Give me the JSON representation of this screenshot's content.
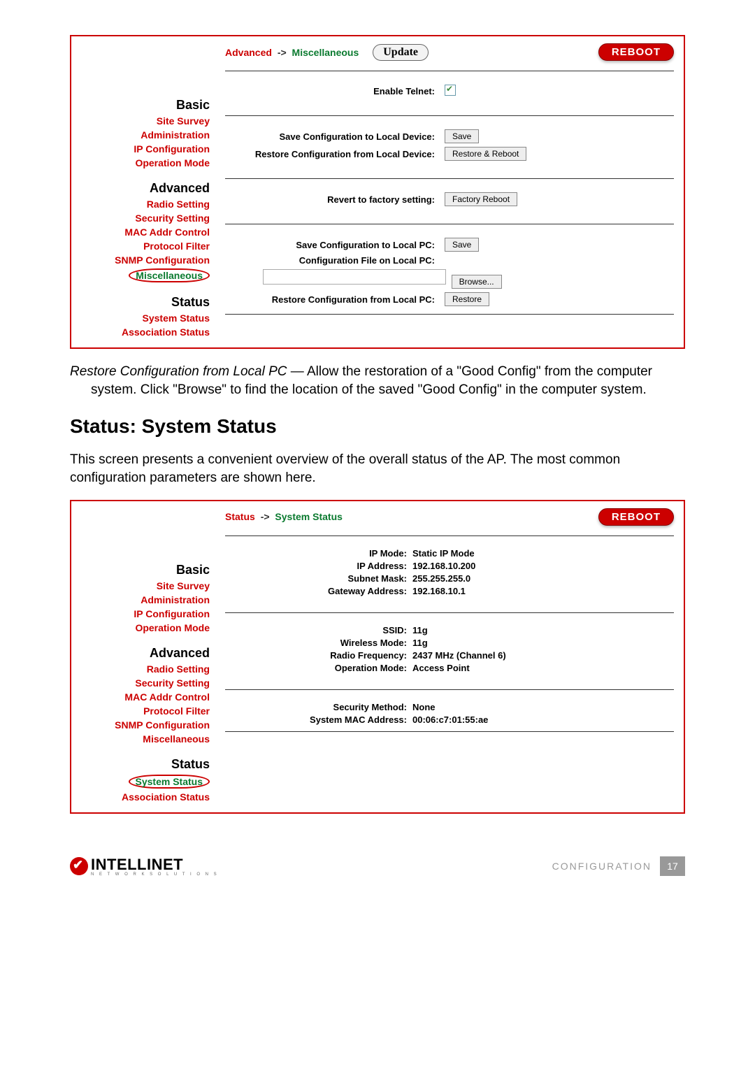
{
  "panel1": {
    "breadcrumb": {
      "root": "Advanced",
      "arrow": "->",
      "leaf": "Miscellaneous"
    },
    "update_btn": "Update",
    "reboot_btn": "REBOOT",
    "sidebar": {
      "basic": "Basic",
      "basic_items": [
        "Site Survey",
        "Administration",
        "IP Configuration",
        "Operation Mode"
      ],
      "advanced": "Advanced",
      "advanced_items": [
        "Radio Setting",
        "Security Setting",
        "MAC Addr Control",
        "Protocol Filter",
        "SNMP Configuration",
        "Miscellaneous"
      ],
      "status": "Status",
      "status_items": [
        "System Status",
        "Association Status"
      ]
    },
    "rows": {
      "enable_telnet": "Enable Telnet:",
      "save_local_device": "Save Configuration to Local Device:",
      "save_btn": "Save",
      "restore_local_device": "Restore Configuration from Local Device:",
      "restore_reboot_btn": "Restore & Reboot",
      "revert_factory": "Revert to factory setting:",
      "factory_reboot_btn": "Factory Reboot",
      "save_local_pc": "Save Configuration to Local PC:",
      "save_pc_btn": "Save",
      "config_file_pc": "Configuration File on Local PC:",
      "browse_btn": "Browse...",
      "restore_local_pc": "Restore Configuration from Local PC:",
      "restore_btn": "Restore"
    }
  },
  "body1": {
    "lead": "Restore Configuration from Local PC",
    "dash": " — ",
    "rest": "Allow the restoration of a \"Good Config\" from the computer system. Click \"Browse\" to find the location of the saved \"Good Config\" in the computer system."
  },
  "section_title": "Status: System Status",
  "body2": "This screen presents a convenient overview of the overall status of the AP. The most common configuration parameters are shown here.",
  "panel2": {
    "breadcrumb": {
      "root": "Status",
      "arrow": "->",
      "leaf": "System Status"
    },
    "reboot_btn": "REBOOT",
    "sidebar": {
      "basic": "Basic",
      "basic_items": [
        "Site Survey",
        "Administration",
        "IP Configuration",
        "Operation Mode"
      ],
      "advanced": "Advanced",
      "advanced_items": [
        "Radio Setting",
        "Security Setting",
        "MAC Addr Control",
        "Protocol Filter",
        "SNMP Configuration",
        "Miscellaneous"
      ],
      "status": "Status",
      "status_items": [
        "System Status",
        "Association Status"
      ]
    },
    "status": {
      "ip_mode_l": "IP Mode:",
      "ip_mode_v": "Static IP Mode",
      "ip_addr_l": "IP Address:",
      "ip_addr_v": "192.168.10.200",
      "subnet_l": "Subnet Mask:",
      "subnet_v": "255.255.255.0",
      "gateway_l": "Gateway Address:",
      "gateway_v": "192.168.10.1",
      "ssid_l": "SSID:",
      "ssid_v": "11g",
      "wmode_l": "Wireless Mode:",
      "wmode_v": "11g",
      "freq_l": "Radio Frequency:",
      "freq_v": "2437 MHz (Channel 6)",
      "opmode_l": "Operation Mode:",
      "opmode_v": "Access Point",
      "sec_l": "Security Method:",
      "sec_v": "None",
      "mac_l": "System MAC Address:",
      "mac_v": "00:06:c7:01:55:ae"
    }
  },
  "footer": {
    "brand": "INTELLINET",
    "brand_sub": "N E T W O R K   S O L U T I O N S",
    "section": "CONFIGURATION",
    "page": "17"
  }
}
